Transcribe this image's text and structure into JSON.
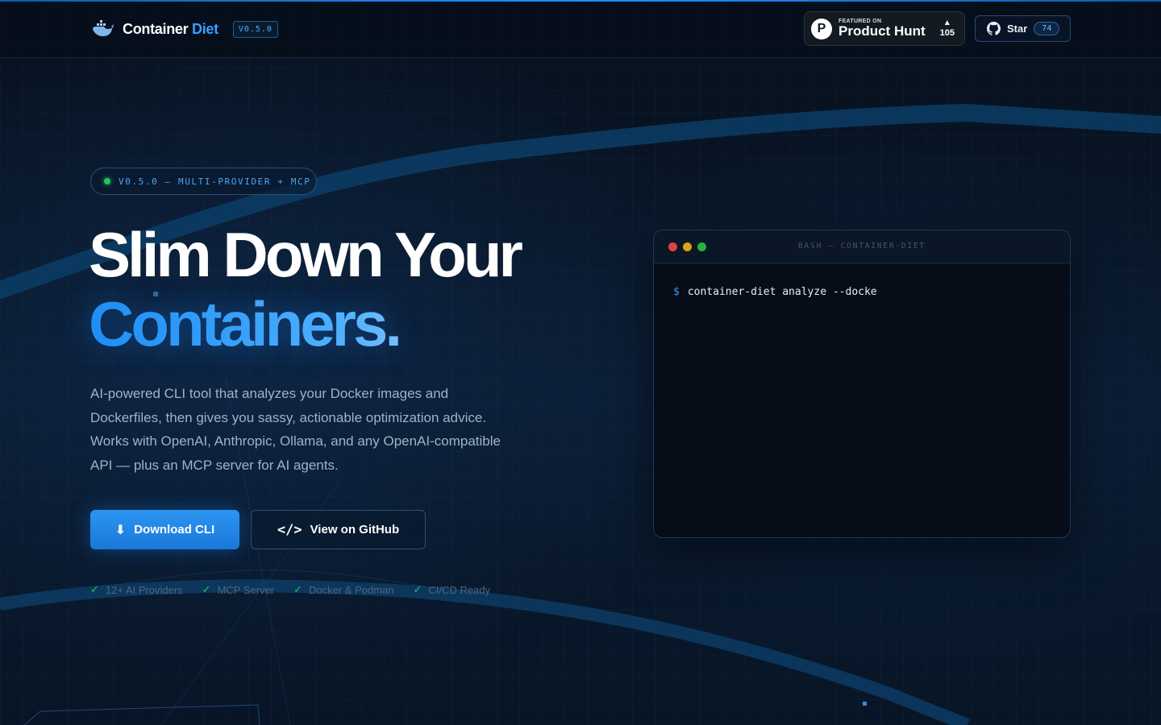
{
  "header": {
    "brand_first": "Container",
    "brand_second": "Diet",
    "version_tag": "V0.5.0",
    "product_hunt": {
      "small": "FEATURED ON",
      "big": "Product Hunt",
      "votes": "105",
      "logo": "P"
    },
    "github": {
      "label": "Star",
      "count": "74"
    }
  },
  "hero": {
    "pill": "V0.5.0 — MULTI-PROVIDER + MCP",
    "title_line1": "Slim Down Your",
    "title_line2": "Containers.",
    "description": "AI-powered CLI tool that analyzes your Docker images and Dockerfiles, then gives you sassy, actionable optimization advice. Works with OpenAI, Anthropic, Ollama, and any OpenAI-compatible API — plus an MCP server for AI agents.",
    "primary_button": "Download CLI",
    "primary_icon": "⬇",
    "secondary_button": "View on GitHub",
    "secondary_icon": "</>",
    "features": [
      "12+ AI Providers",
      "MCP Server",
      "Docker & Podman",
      "CI/CD Ready"
    ],
    "check": "✓"
  },
  "terminal": {
    "title": "BASH — CONTAINER-DIET",
    "prompt": "$",
    "command": "container-diet analyze --docke"
  },
  "icons": [
    "whale-logo-icon",
    "product-hunt-icon",
    "upvote-arrow-icon",
    "github-icon",
    "download-icon",
    "code-icon",
    "check-icon"
  ],
  "colors": {
    "accent": "#2a9cf5",
    "background": "#07111f",
    "success": "#22c55e"
  }
}
